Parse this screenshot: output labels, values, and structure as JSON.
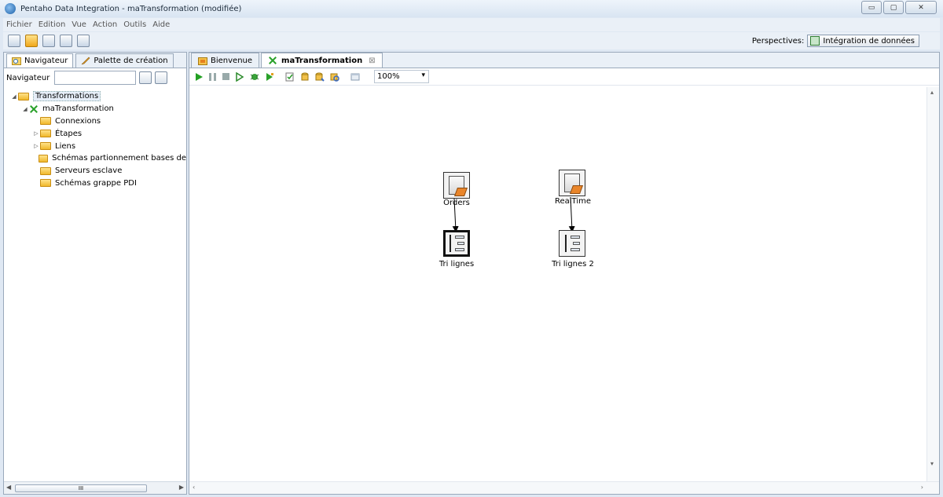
{
  "window": {
    "title": "Pentaho Data Integration - maTransformation (modifiée)",
    "buttons": [
      "▭",
      "▢",
      "✕"
    ]
  },
  "menu": [
    "Fichier",
    "Edition",
    "Vue",
    "Action",
    "Outils",
    "Aide"
  ],
  "toolbar": {
    "perspectives_label": "Perspectives:",
    "perspective_value": "Intégration de données"
  },
  "left_panel": {
    "tabs": [
      "Navigateur",
      "Palette de création"
    ],
    "navigator_label": "Navigateur",
    "tree": [
      {
        "label": "Transformations",
        "level": 0,
        "arrow": "◢",
        "icon": "folder"
      },
      {
        "label": "maTransformation",
        "level": 1,
        "arrow": "◢",
        "icon": "transformation"
      },
      {
        "label": "Connexions",
        "level": 2,
        "arrow": "",
        "icon": "folder"
      },
      {
        "label": "Étapes",
        "level": 2,
        "arrow": "▷",
        "icon": "folder"
      },
      {
        "label": "Liens",
        "level": 2,
        "arrow": "▷",
        "icon": "folder"
      },
      {
        "label": "Schémas partionnement bases de",
        "level": 2,
        "arrow": "",
        "icon": "folder"
      },
      {
        "label": "Serveurs esclave",
        "level": 2,
        "arrow": "",
        "icon": "folder"
      },
      {
        "label": "Schémas grappe PDI",
        "level": 2,
        "arrow": "",
        "icon": "folder"
      }
    ],
    "scroll_thumb": "III"
  },
  "editor": {
    "tabs": [
      {
        "label": "Bienvenue",
        "active": false
      },
      {
        "label": "maTransformation",
        "active": true
      }
    ],
    "zoom": "100%",
    "steps": [
      {
        "label": "Orders",
        "type": "input"
      },
      {
        "label": "Tri lignes",
        "type": "sort"
      },
      {
        "label": "RealTime",
        "type": "input"
      },
      {
        "label": "Tri lignes 2",
        "type": "sort"
      }
    ]
  }
}
